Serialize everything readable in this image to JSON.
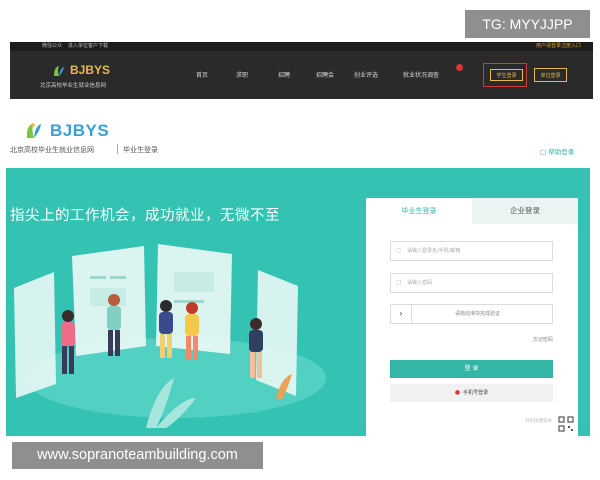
{
  "watermark": {
    "tag": "TG: MYYJJPP",
    "url": "www.sopranoteambuilding.com"
  },
  "top_bar": {
    "left_links": [
      "微信公众",
      "进入单位客户下载"
    ],
    "right_link": "用户请登录注册入口",
    "logo_text": "BJBYS",
    "logo_sub": "北京高校毕业生就业信息网",
    "nav": [
      "首页",
      "求职",
      "招聘",
      "招聘会",
      "创业评选",
      "就业状况调查"
    ],
    "login_graduate": "学生登录",
    "login_org": "单位登录"
  },
  "header": {
    "logo_text": "BJBYS",
    "site_name": "北京高校毕业生就业信息网",
    "role": "毕业生登录",
    "help": "帮助登录"
  },
  "hero": {
    "title": "指尖上的工作机会，成功就业，无微不至"
  },
  "login_panel": {
    "tabs": [
      "毕业生登录",
      "企业登录"
    ],
    "username_placeholder": "请输入登录名/手机/邮箱",
    "password_placeholder": "请输入密码",
    "slider_text": "请拖动滑块完成验证",
    "forgot": "忘记密码",
    "login_button": "登 录",
    "mobile_login": "手机号登录",
    "scan_hint": "扫码快捷登录"
  },
  "colors": {
    "teal": "#34c2b3",
    "accent": "#34b5a6",
    "gold": "#e6b94a",
    "red": "#d23b3b"
  }
}
